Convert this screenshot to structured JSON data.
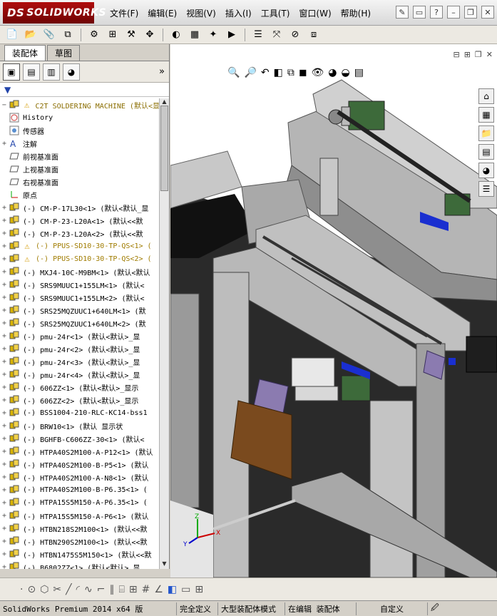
{
  "app": {
    "brand_prefix": "DS",
    "brand": "SOLIDWORKS"
  },
  "menu": [
    "文件(F)",
    "编辑(E)",
    "视图(V)",
    "插入(I)",
    "工具(T)",
    "窗口(W)",
    "帮助(H)"
  ],
  "tabs": {
    "assembly": "装配体",
    "sketch": "草图"
  },
  "tree": {
    "root": "C2T SOLDERING MACHINE  (默认<显",
    "items": [
      {
        "label": "History",
        "exp": "",
        "kind": "history"
      },
      {
        "label": "传感器",
        "exp": "",
        "kind": "sensor"
      },
      {
        "label": "注解",
        "exp": "+",
        "kind": "note"
      },
      {
        "label": "前视基准面",
        "exp": "",
        "kind": "plane"
      },
      {
        "label": "上视基准面",
        "exp": "",
        "kind": "plane"
      },
      {
        "label": "右视基准面",
        "exp": "",
        "kind": "plane"
      },
      {
        "label": "原点",
        "exp": "",
        "kind": "origin"
      },
      {
        "label": "(-) CM-P-17L30<1> (默认<默认_显",
        "exp": "+",
        "kind": "part"
      },
      {
        "label": "(-) CM-P-23-L20A<1> (默认<<默",
        "exp": "+",
        "kind": "part"
      },
      {
        "label": "(-) CM-P-23-L20A<2> (默认<<默",
        "exp": "+",
        "kind": "part"
      },
      {
        "label": "(-) PPUS-SD10-30-TP-QS<1> (",
        "exp": "+",
        "kind": "warn"
      },
      {
        "label": "(-) PPUS-SD10-30-TP-QS<2> (",
        "exp": "+",
        "kind": "warn"
      },
      {
        "label": "(-) MXJ4-10C-M9BM<1> (默认<默认",
        "exp": "+",
        "kind": "part"
      },
      {
        "label": "(-) SRS9MUUC1+155LM<1> (默认<",
        "exp": "+",
        "kind": "part"
      },
      {
        "label": "(-) SRS9MUUC1+155LM<2> (默认<",
        "exp": "+",
        "kind": "part"
      },
      {
        "label": "(-) SRS25MQZUUC1+640LM<1> (默",
        "exp": "+",
        "kind": "part"
      },
      {
        "label": "(-) SRS25MQZUUC1+640LM<2> (默",
        "exp": "+",
        "kind": "part"
      },
      {
        "label": "(-) pmu-24r<1> (默认<默认>_显",
        "exp": "+",
        "kind": "part"
      },
      {
        "label": "(-) pmu-24r<2> (默认<默认>_显",
        "exp": "+",
        "kind": "part"
      },
      {
        "label": "(-) pmu-24r<3> (默认<默认>_显",
        "exp": "+",
        "kind": "part"
      },
      {
        "label": "(-) pmu-24r<4> (默认<默认>_显",
        "exp": "+",
        "kind": "part"
      },
      {
        "label": "(-) 606ZZ<1> (默认<默认>_显示",
        "exp": "+",
        "kind": "part"
      },
      {
        "label": "(-) 606ZZ<2> (默认<默认>_显示",
        "exp": "+",
        "kind": "part"
      },
      {
        "label": "(-) BSS1004-210-RLC-KC14-bss1",
        "exp": "+",
        "kind": "part"
      },
      {
        "label": "(-) BRW10<1> (默认 显示状",
        "exp": "+",
        "kind": "part"
      },
      {
        "label": "(-) BGHFB-C606ZZ-30<1> (默认<",
        "exp": "+",
        "kind": "part"
      },
      {
        "label": "(-) HTPA40S2M100-A-P12<1> (默认",
        "exp": "+",
        "kind": "part"
      },
      {
        "label": "(-) HTPA40S2M100-B-P5<1> (默认",
        "exp": "+",
        "kind": "part"
      },
      {
        "label": "(-) HTPA40S2M100-A-N8<1> (默认",
        "exp": "+",
        "kind": "part"
      },
      {
        "label": "(-) HTPA40S2M100-B-P6.35<1> (",
        "exp": "+",
        "kind": "part"
      },
      {
        "label": "(-) HTPA15S5M150-A-P6.35<1> (",
        "exp": "+",
        "kind": "part"
      },
      {
        "label": "(-) HTPA15S5M150-A-P6<1> (默认",
        "exp": "+",
        "kind": "part"
      },
      {
        "label": "(-) HTBN218S2M100<1> (默认<<默",
        "exp": "+",
        "kind": "part"
      },
      {
        "label": "(-) HTBN290S2M100<1> (默认<<默",
        "exp": "+",
        "kind": "part"
      },
      {
        "label": "(-) HTBN1475S5M150<1> (默认<<默",
        "exp": "+",
        "kind": "part"
      },
      {
        "label": "(-) B6802ZZ<1> (默认<默认>_显",
        "exp": "+",
        "kind": "part"
      }
    ]
  },
  "status": {
    "product": "SolidWorks Premium 2014 x64 版",
    "constraint": "完全定义",
    "mode": "大型装配体模式",
    "editing": "在编辑 装配体",
    "custom": "自定义"
  },
  "colors": {
    "logo": "#b00d0d",
    "machine_gray": "#9a9a9a",
    "motor_green": "#3d6a3a",
    "accent_blue": "#1a2fd0",
    "wood_brown": "#7a4a1e"
  }
}
